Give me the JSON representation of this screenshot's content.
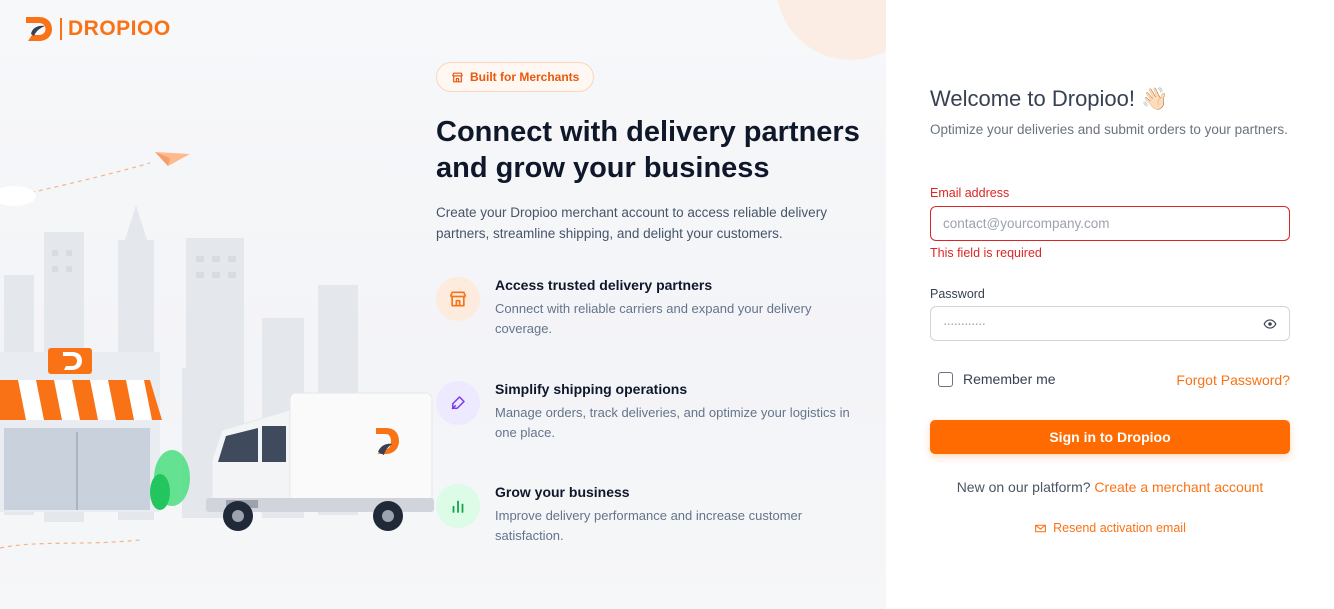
{
  "brand": {
    "name": "DROPIOO",
    "accent": "#f97316"
  },
  "hero": {
    "badge": "Built for Merchants",
    "title": "Connect with delivery partners and grow your business",
    "subtitle": "Create your Dropioo merchant account to access reliable delivery partners, streamline shipping, and delight your customers."
  },
  "features": [
    {
      "title": "Access trusted delivery partners",
      "desc": "Connect with reliable carriers and expand your delivery coverage.",
      "icon": "store-icon",
      "color": "#f97316"
    },
    {
      "title": "Simplify shipping operations",
      "desc": "Manage orders, track deliveries, and optimize your logistics in one place.",
      "icon": "pen-tool-icon",
      "color": "#7c3aed"
    },
    {
      "title": "Grow your business",
      "desc": "Improve delivery performance and increase customer satisfaction.",
      "icon": "bar-chart-icon",
      "color": "#16a34a"
    }
  ],
  "login": {
    "welcome": "Welcome to Dropioo!",
    "welcome_emoji": "👋🏻",
    "subtitle": "Optimize your deliveries and submit orders to your partners.",
    "email_label": "Email address",
    "email_placeholder": "contact@yourcompany.com",
    "email_error": "This field is required",
    "password_label": "Password",
    "password_value": "············",
    "remember_label": "Remember me",
    "forgot_label": "Forgot Password?",
    "signin_label": "Sign in to Dropioo",
    "new_text": "New on our platform?",
    "create_label": "Create a merchant account",
    "resend_label": "Resend activation email"
  }
}
